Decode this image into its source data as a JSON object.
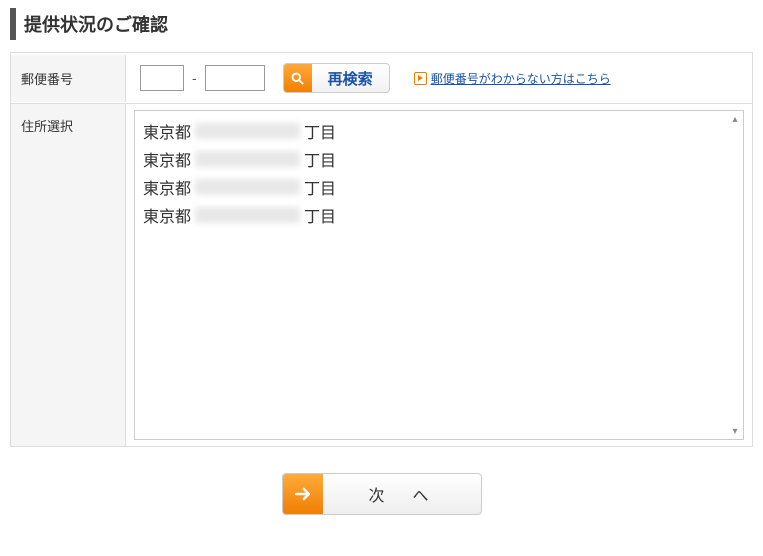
{
  "title": "提供状況のご確認",
  "postal": {
    "label": "郵便番号",
    "value1": "",
    "value2": "",
    "dash": "-",
    "search_label": "再検索",
    "help_link": "郵便番号がわからない方はこちら"
  },
  "address": {
    "label": "住所選択",
    "items": [
      {
        "prefix": "東京都",
        "suffix": "丁目"
      },
      {
        "prefix": "東京都",
        "suffix": "丁目"
      },
      {
        "prefix": "東京都",
        "suffix": "丁目"
      },
      {
        "prefix": "東京都",
        "suffix": "丁目"
      }
    ]
  },
  "next_label": "次　へ"
}
